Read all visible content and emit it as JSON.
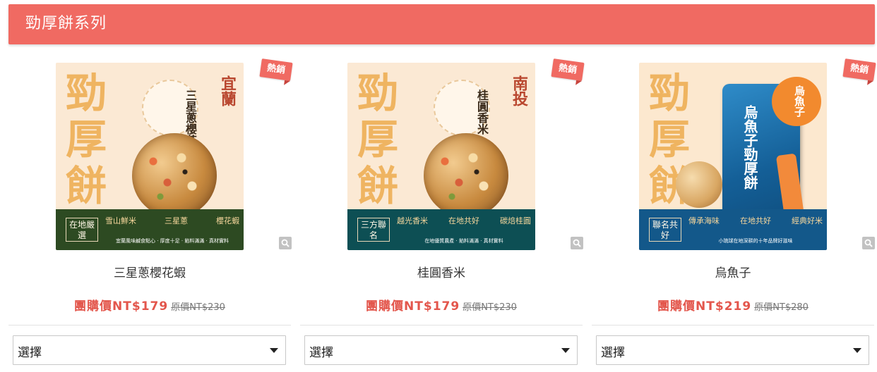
{
  "section": {
    "title": "勁厚餅系列"
  },
  "colors": {
    "header": "#f06a62",
    "price": "#e3564c",
    "badge": "#f06a62"
  },
  "products": [
    {
      "name": "三星蔥櫻花蝦",
      "hot_badge": "熱銷",
      "group_price": "團購價NT$179",
      "original_price": "原價NT$230",
      "select_value": "選擇",
      "image": {
        "big_chars": [
          "勁",
          "厚",
          "餅"
        ],
        "flavor": "三星蔥櫻花蝦",
        "region": "宜蘭",
        "band_label": "在地嚴選",
        "band_items": [
          "雪山鮮米",
          "三星蔥",
          "櫻花蝦"
        ],
        "band_sub": "宜蘭風味鹹食點心 · 厚度十足 · 餡料滿滿 · 真材實料"
      }
    },
    {
      "name": "桂圓香米",
      "hot_badge": "熱銷",
      "group_price": "團購價NT$179",
      "original_price": "原價NT$230",
      "select_value": "選擇",
      "image": {
        "big_chars": [
          "勁",
          "厚",
          "餅"
        ],
        "flavor": "桂圓香米",
        "region": "南投",
        "band_label": "三方聯名",
        "band_items": [
          "越光香米",
          "在地共好",
          "碳焙桂圓"
        ],
        "band_sub": "在地優質農產 · 餡料滿滿 · 真材實料"
      }
    },
    {
      "name": "烏魚子",
      "hot_badge": "熱銷",
      "group_price": "團購價NT$219",
      "original_price": "原價NT$280",
      "select_value": "選擇",
      "image": {
        "big_chars": [
          "勁",
          "厚",
          "餅"
        ],
        "flavor": "烏魚子",
        "bag_text": "烏魚子勁厚餅",
        "band_label": "聯名共好",
        "band_items": [
          "傳承海味",
          "在地共好",
          "經典好米"
        ],
        "band_sub": "小琉球在地深耕的十年品牌好滋味"
      }
    }
  ]
}
